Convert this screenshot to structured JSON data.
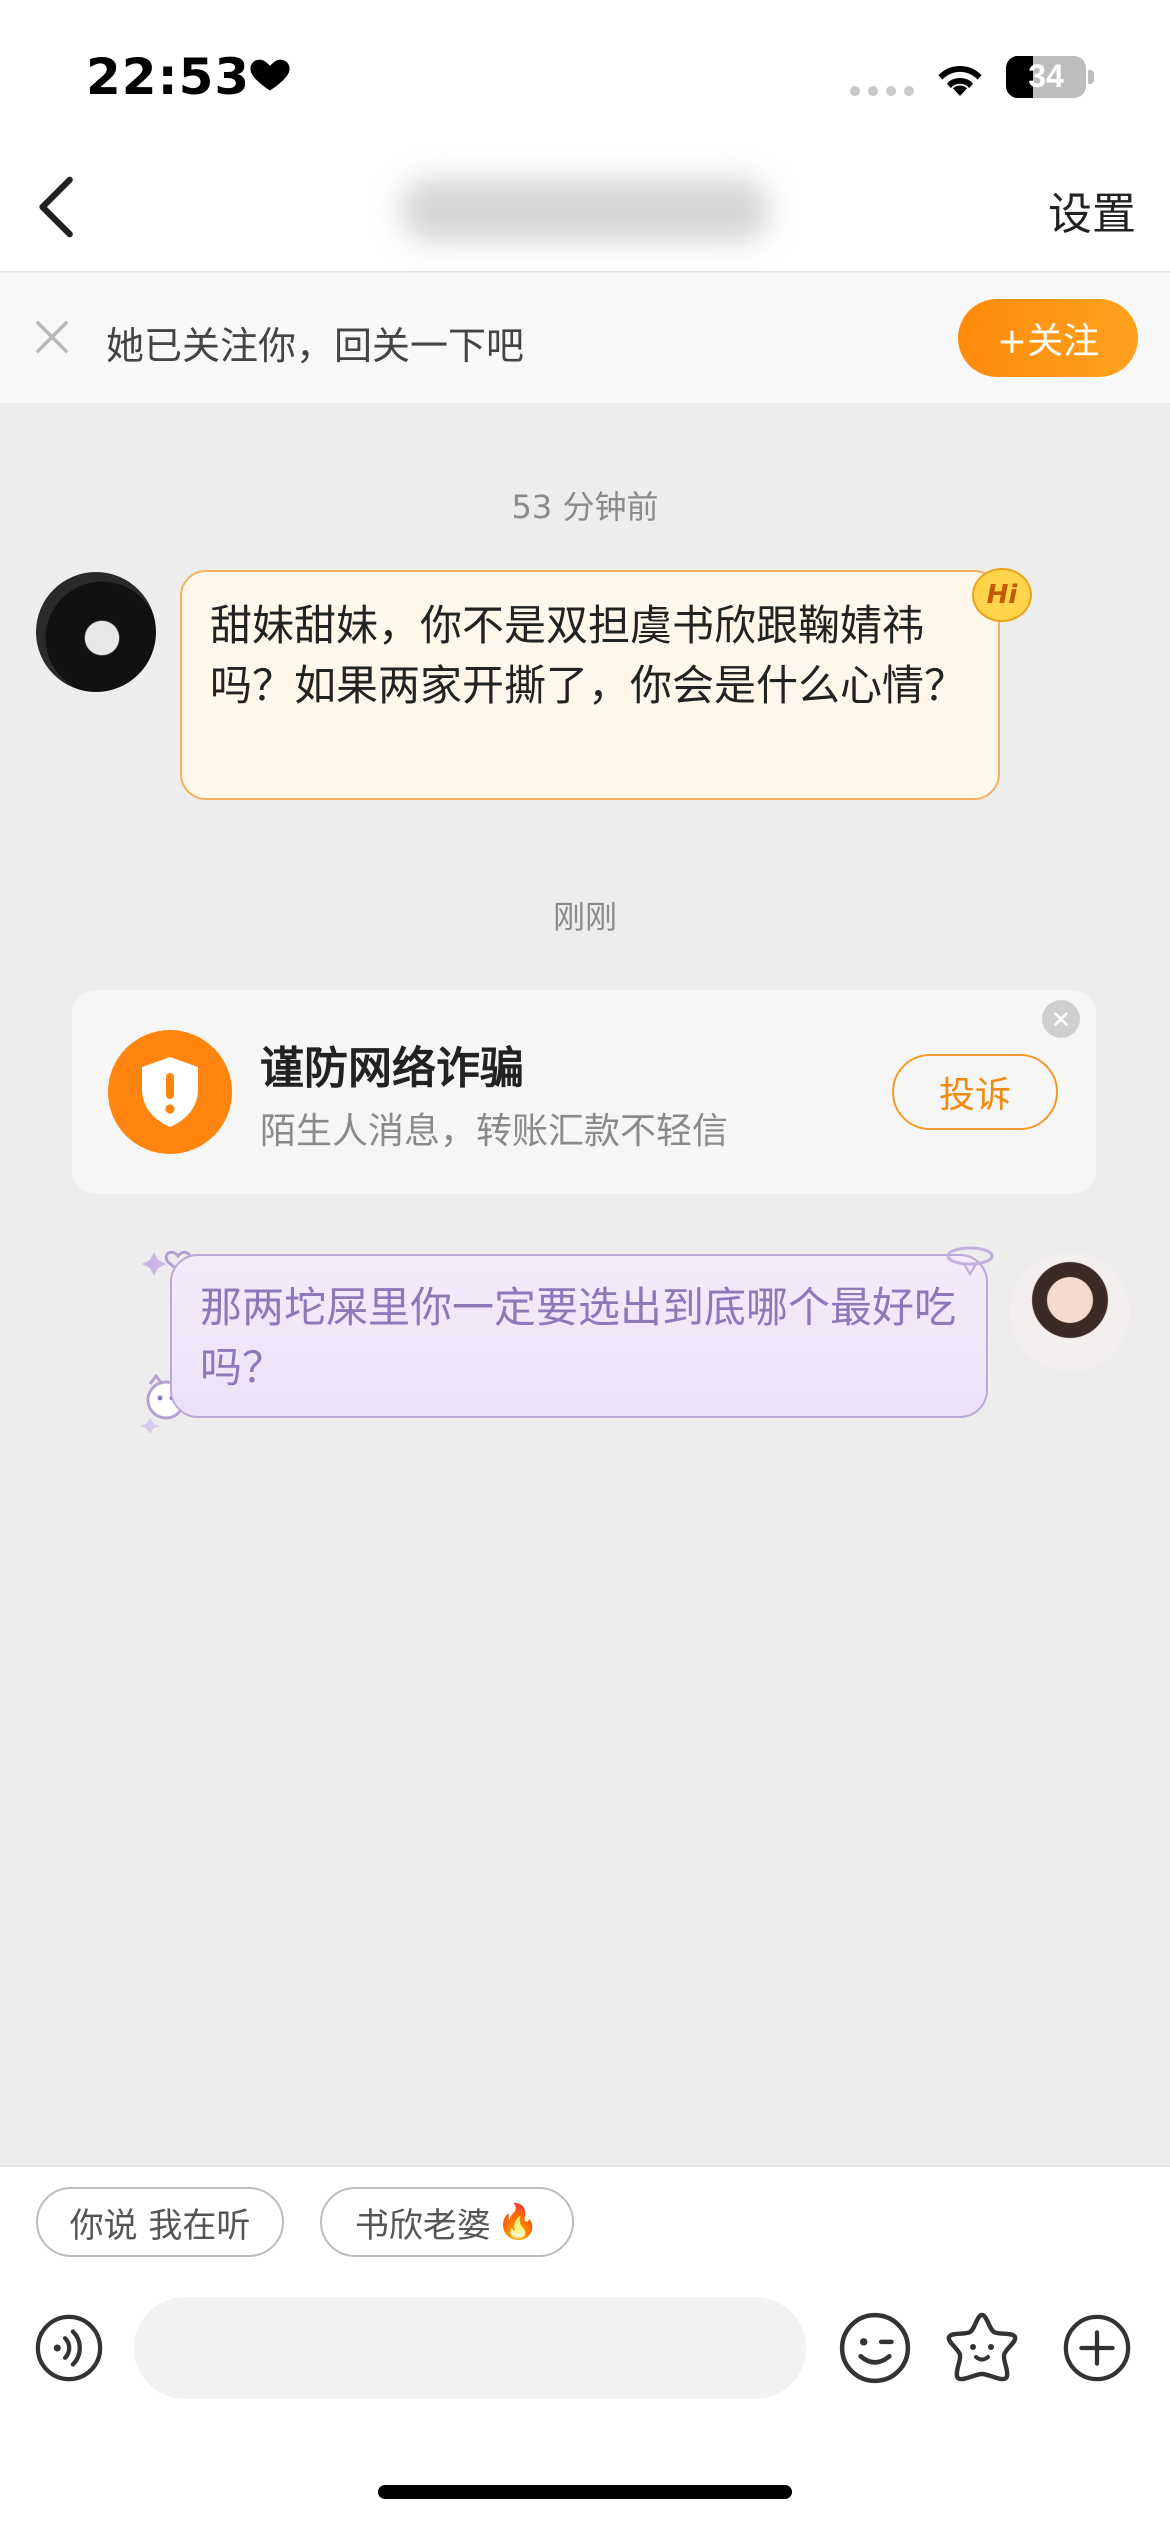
{
  "status_bar": {
    "time": "22:53",
    "battery_level": "34",
    "battery_fraction": 0.34,
    "icons": [
      "heart-icon",
      "signal-icon",
      "wifi-icon",
      "battery-icon"
    ]
  },
  "nav": {
    "back_icon": "chevron-left-icon",
    "title_hidden": true,
    "settings_label": "设置"
  },
  "follow_banner": {
    "close_icon": "close-icon",
    "text": "她已关注你，回关一下吧",
    "follow_label": "+关注"
  },
  "chat": {
    "messages": [
      {
        "timestamp": "53 分钟前",
        "side": "left",
        "badge": "Hi",
        "text": "甜妹甜妹，你不是双担虞书欣跟鞠婧祎吗？如果两家开撕了，你会是什么心情？"
      },
      {
        "timestamp": "刚刚",
        "side": "right",
        "text": "那两坨屎里你一定要选出到底哪个最好吃吗？"
      }
    ],
    "warning_card": {
      "icon": "shield-alert-icon",
      "title": "谨防网络诈骗",
      "subtitle": "陌生人消息，转账汇款不轻信",
      "report_label": "投诉",
      "close_icon": "close-icon"
    }
  },
  "quick_replies": [
    {
      "label": "你说 我在听",
      "emoji": ""
    },
    {
      "label": "书欣老婆",
      "emoji": "🔥"
    }
  ],
  "input_bar": {
    "voice_icon": "voice-icon",
    "input_value": "",
    "input_placeholder": "",
    "emoji_icon": "emoji-icon",
    "star_icon": "star-icon",
    "plus_icon": "plus-icon"
  },
  "colors": {
    "accent_orange": "#ff8a0a",
    "left_bubble_bg": "#fff8ea",
    "left_bubble_border": "#f0b25c",
    "right_bubble_bg": "#f1e9fa",
    "right_bubble_text": "#8e79b8",
    "chat_bg": "#ededed"
  }
}
